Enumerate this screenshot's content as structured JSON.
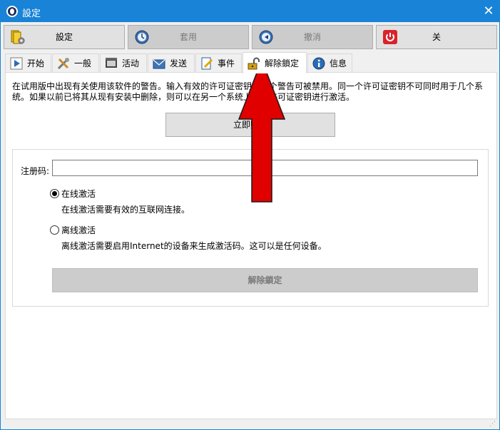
{
  "window": {
    "title": "設定",
    "close_glyph": "✕",
    "accent_color": "#1883d7"
  },
  "toolbar": {
    "buttons": [
      {
        "label": "設定",
        "icon": "settings-book-icon",
        "enabled": true
      },
      {
        "label": "套用",
        "icon": "clock-apply-icon",
        "enabled": false
      },
      {
        "label": "撤消",
        "icon": "undo-clock-icon",
        "enabled": false
      },
      {
        "label": "关",
        "icon": "power-icon",
        "enabled": true
      }
    ]
  },
  "tabs": [
    {
      "label": "开始",
      "icon": "play-icon"
    },
    {
      "label": "一般",
      "icon": "tools-icon"
    },
    {
      "label": "活动",
      "icon": "film-icon"
    },
    {
      "label": "发送",
      "icon": "mail-icon"
    },
    {
      "label": "事件",
      "icon": "document-pencil-icon"
    },
    {
      "label": "解除鎖定",
      "icon": "unlock-icon",
      "active": true
    },
    {
      "label": "信息",
      "icon": "info-icon"
    }
  ],
  "unlock": {
    "warning": "在试用版中出现有关使用该软件的警告。输入有效的许可证密钥，这个警告可被禁用。同一个许可证密钥不可同时用于几个系统。如果以前已将其从现有安装中删除，则可以在另一个系统上使用许可证密钥进行激活。",
    "activate_now": "立即购买",
    "reg_label": "注册码:",
    "reg_value": "",
    "online_label": "在线激活",
    "online_desc": "在线激活需要有效的互联网连接。",
    "offline_label": "离线激活",
    "offline_desc": "离线激活需要启用Internet的设备来生成激活码。这可以是任何设备。",
    "unlock_button": "解除鎖定",
    "selected_mode": "online"
  },
  "overlay": {
    "arrow_color": "#e00000"
  }
}
